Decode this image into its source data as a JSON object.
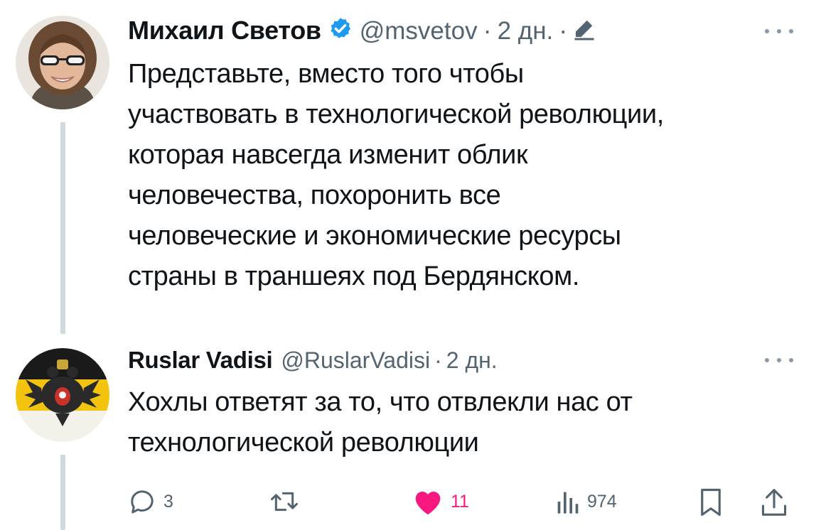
{
  "tweet1": {
    "name": "Михаил Светов",
    "handle": "@msvetov",
    "separator": "·",
    "time": "2 дн.",
    "text": "Представьте, вместо того чтобы\nучаствовать в технологической революции,\nкоторая навсегда изменит облик\nчеловечества, похоронить все\nчеловеческие и экономические ресурсы\nстраны в траншеях под Бердянском.",
    "verified_color": "#1d9bf0"
  },
  "tweet2": {
    "name": "Ruslar Vadisi",
    "handle": "@RuslarVadisi",
    "separator": "·",
    "time": "2 дн.",
    "text": "Хохлы ответят за то, что отвлекли нас от\nтехнологической революции"
  },
  "actions": {
    "replies": "3",
    "likes": "11",
    "views": "974",
    "like_color": "#f91880",
    "icons": [
      "reply-icon",
      "retweet-icon",
      "like-icon",
      "views-icon",
      "bookmark-icon",
      "share-icon"
    ]
  }
}
